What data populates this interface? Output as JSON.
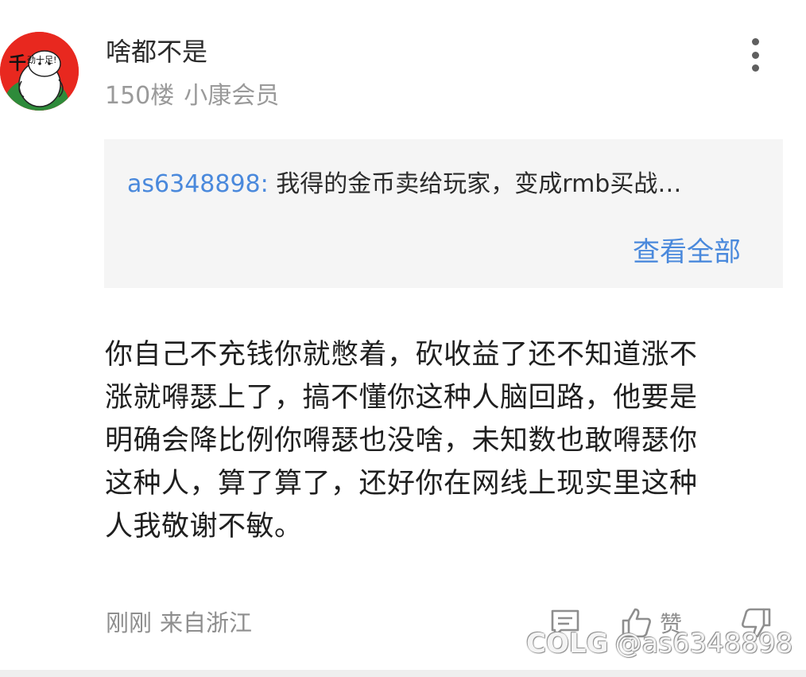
{
  "comment": {
    "author": "啥都不是",
    "floor": "150楼",
    "badge": "小康会员",
    "avatar_text": "千",
    "avatar_caption": "劲十足!",
    "quote": {
      "user": "as6348898:",
      "text": "我得的金币卖给玩家，变成rmb买战…",
      "view_all": "查看全部"
    },
    "body_lines": [
      "你自己不充钱你就憋着，砍收益了还不知道涨不",
      "涨就嘚瑟上了，搞不懂你这种人脑回路，他要是",
      "明确会降比例你嘚瑟也没啥，未知数也敢嘚瑟你",
      "这种人，算了算了，还好你在网线上现实里这种",
      "人我敬谢不敏。"
    ],
    "time": "刚刚",
    "location": "来自浙江",
    "like_label": "赞"
  },
  "watermark": {
    "brand": "COLG",
    "user": "@as6348898"
  },
  "colors": {
    "link": "#4a89dc",
    "avatar_bg": "#e8281f",
    "quote_bg": "#f5f5f5",
    "muted": "#9a9a9a"
  },
  "icons": [
    "more-vertical-icon",
    "comment-icon",
    "thumbs-up-icon",
    "thumbs-down-icon"
  ]
}
